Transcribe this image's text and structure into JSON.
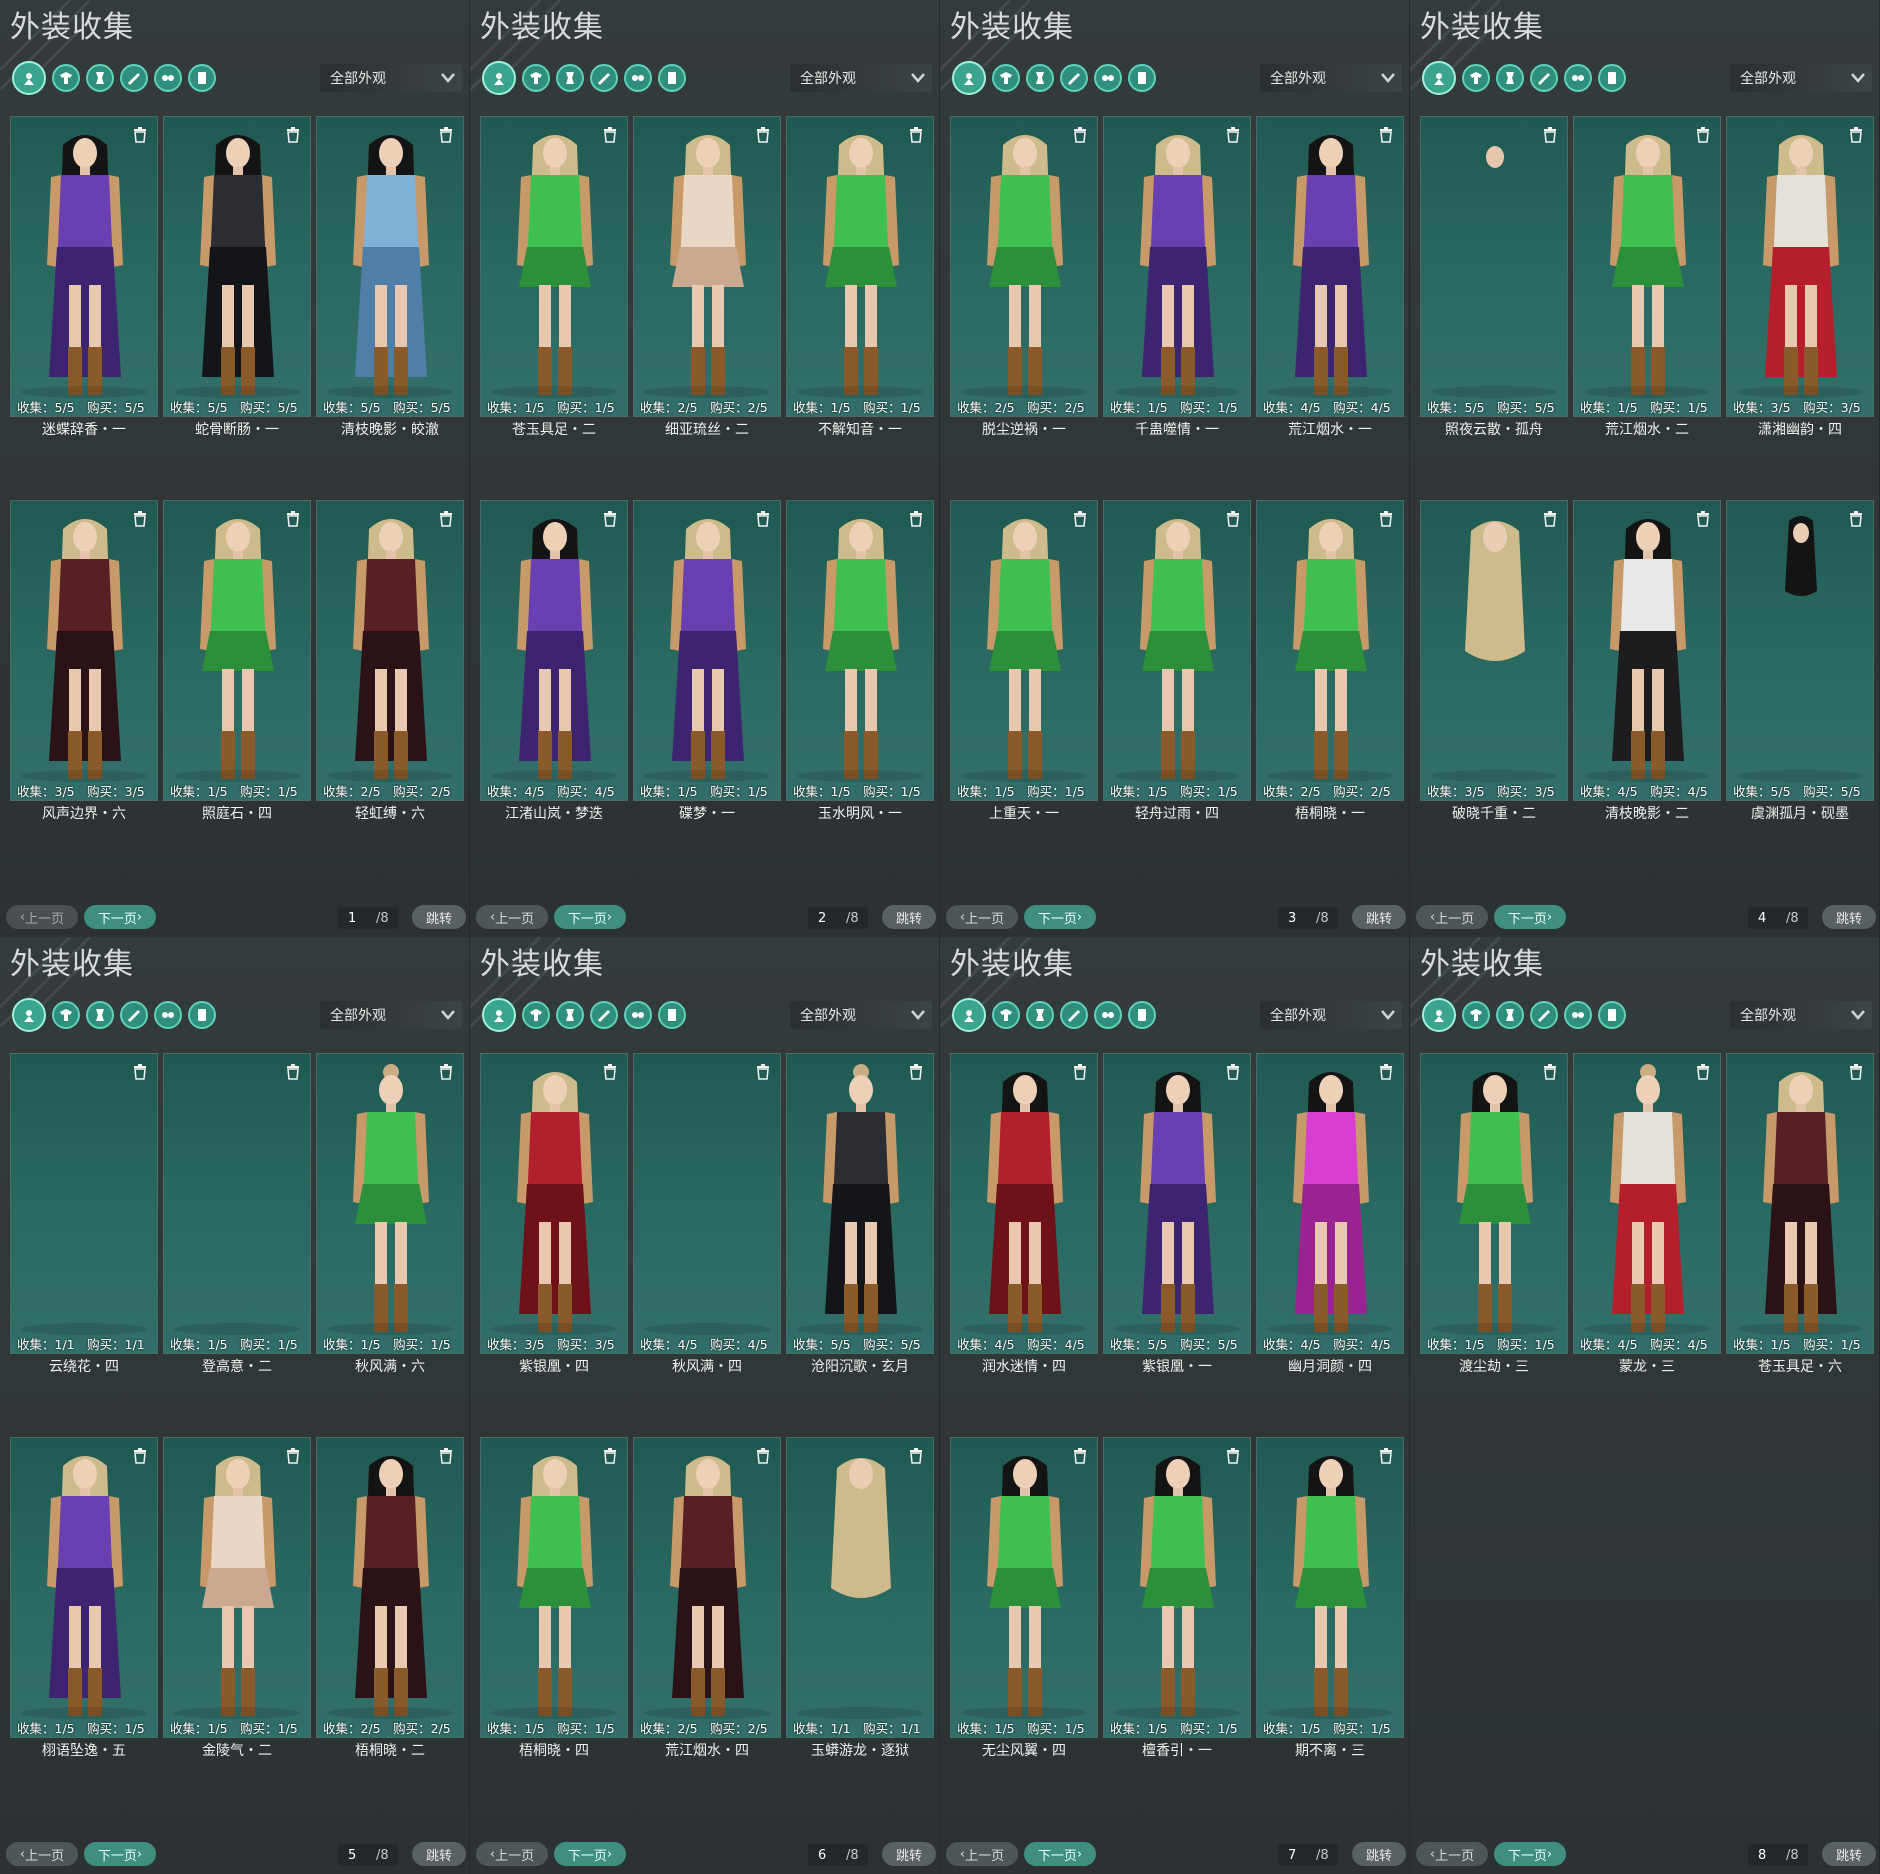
{
  "app": {
    "accent": "#3aa48d",
    "teal": "#2a6a62"
  },
  "panels": [
    {
      "title": "外装收集",
      "filter": "全部外观",
      "page": "1",
      "total": "/8",
      "pager": {
        "prev": "上一页",
        "next": "下一页",
        "jump": "跳转"
      },
      "items": [
        {
          "stats": "收集：5/5　购买：5/5",
          "name": "迷蝶辞香・一",
          "outfit": "purple",
          "hair": "dark"
        },
        {
          "stats": "收集：5/5　购买：5/5",
          "name": "蛇骨断肠・一",
          "outfit": "black",
          "hair": "dark"
        },
        {
          "stats": "收集：5/5　购买：5/5",
          "name": "清枝晚影・皎澈",
          "outfit": "blue",
          "hair": "dark"
        },
        {
          "stats": "收集：3/5　购买：3/5",
          "name": "风声边界・六",
          "outfit": "darkred",
          "hair": "blonde"
        },
        {
          "stats": "收集：1/5　购买：1/5",
          "name": "照庭石・四",
          "outfit": "green",
          "hair": "blonde"
        },
        {
          "stats": "收集：2/5　购买：2/5",
          "name": "轻虹缚・六",
          "outfit": "darkred",
          "hair": "blonde"
        }
      ]
    },
    {
      "title": "外装收集",
      "filter": "全部外观",
      "page": "2",
      "total": "/8",
      "pager": {
        "prev": "上一页",
        "next": "下一页",
        "jump": "跳转"
      },
      "items": [
        {
          "stats": "收集：1/5　购买：1/5",
          "name": "苍玉具足・二",
          "outfit": "green",
          "hair": "blonde"
        },
        {
          "stats": "收集：2/5　购买：2/5",
          "name": "细亚琉丝・二",
          "outfit": "nude",
          "hair": "blonde"
        },
        {
          "stats": "收集：1/5　购买：1/5",
          "name": "不解知音・一",
          "outfit": "green",
          "hair": "blonde"
        },
        {
          "stats": "收集：4/5　购买：4/5",
          "name": "江渚山岚・梦迭",
          "outfit": "purple",
          "hair": "dark"
        },
        {
          "stats": "收集：1/5　购买：1/5",
          "name": "碟梦・一",
          "outfit": "purple",
          "hair": "blonde"
        },
        {
          "stats": "收集：1/5　购买：1/5",
          "name": "玉水明风・一",
          "outfit": "green",
          "hair": "blonde"
        }
      ]
    },
    {
      "title": "外装收集",
      "filter": "全部外观",
      "page": "3",
      "total": "/8",
      "pager": {
        "prev": "上一页",
        "next": "下一页",
        "jump": "跳转"
      },
      "items": [
        {
          "stats": "收集：2/5　购买：2/5",
          "name": "脱尘逆祸・一",
          "outfit": "green",
          "hair": "blonde"
        },
        {
          "stats": "收集：1/5　购买：1/5",
          "name": "千蛊噬情・一",
          "outfit": "purple",
          "hair": "blonde"
        },
        {
          "stats": "收集：4/5　购买：4/5",
          "name": "荒江烟水・一",
          "outfit": "purple",
          "hair": "dark"
        },
        {
          "stats": "收集：1/5　购买：1/5",
          "name": "上重天・一",
          "outfit": "green",
          "hair": "blonde"
        },
        {
          "stats": "收集：1/5　购买：1/5",
          "name": "轻舟过雨・四",
          "outfit": "green",
          "hair": "blonde"
        },
        {
          "stats": "收集：2/5　购买：2/5",
          "name": "梧桐晓・一",
          "outfit": "green",
          "hair": "blonde"
        }
      ]
    },
    {
      "title": "外装收集",
      "filter": "全部外观",
      "page": "4",
      "total": "/8",
      "pager": {
        "prev": "上一页",
        "next": "下一页",
        "jump": "跳转"
      },
      "items": [
        {
          "stats": "收集：5/5　购买：5/5",
          "name": "照夜云散・孤舟",
          "outfit": "head",
          "hair": "none"
        },
        {
          "stats": "收集：1/5　购买：1/5",
          "name": "荒江烟水・二",
          "outfit": "green",
          "hair": "blonde"
        },
        {
          "stats": "收集：3/5　购买：3/5",
          "name": "潇湘幽韵・四",
          "outfit": "redwhite",
          "hair": "blonde"
        },
        {
          "stats": "收集：3/5　购买：3/5",
          "name": "破晓千重・二",
          "outfit": "haironly",
          "hair": "blonde"
        },
        {
          "stats": "收集：4/5　购买：4/5",
          "name": "清枝晚影・二",
          "outfit": "whiteblack",
          "hair": "dark"
        },
        {
          "stats": "收集：5/5　购买：5/5",
          "name": "虞渊孤月・砚墨",
          "outfit": "hairdark",
          "hair": "dark"
        }
      ]
    },
    {
      "title": "外装收集",
      "filter": "全部外观",
      "page": "5",
      "total": "/8",
      "pager": {
        "prev": "上一页",
        "next": "下一页",
        "jump": "跳转"
      },
      "items": [
        {
          "stats": "收集：1/1　购买：1/1",
          "name": "云绕花・四",
          "outfit": "empty",
          "hair": "none"
        },
        {
          "stats": "收集：1/5　购买：1/5",
          "name": "登高意・二",
          "outfit": "empty",
          "hair": "none"
        },
        {
          "stats": "收集：1/5　购买：1/5",
          "name": "秋风满・六",
          "outfit": "green",
          "hair": "bun"
        },
        {
          "stats": "收集：1/5　购买：1/5",
          "name": "栩语坠逸・五",
          "outfit": "purple",
          "hair": "blonde"
        },
        {
          "stats": "收集：1/5　购买：1/5",
          "name": "金陵气・二",
          "outfit": "nude",
          "hair": "blonde"
        },
        {
          "stats": "收集：2/5　购买：2/5",
          "name": "梧桐晓・二",
          "outfit": "darkred",
          "hair": "dark"
        }
      ]
    },
    {
      "title": "外装收集",
      "filter": "全部外观",
      "page": "6",
      "total": "/8",
      "pager": {
        "prev": "上一页",
        "next": "下一页",
        "jump": "跳转"
      },
      "items": [
        {
          "stats": "收集：3/5　购买：3/5",
          "name": "紫银凰・四",
          "outfit": "red",
          "hair": "blonde"
        },
        {
          "stats": "收集：4/5　购买：4/5",
          "name": "秋风满・四",
          "outfit": "empty",
          "hair": "none"
        },
        {
          "stats": "收集：5/5　购买：5/5",
          "name": "沧阳沉歌・玄月",
          "outfit": "black",
          "hair": "bun"
        },
        {
          "stats": "收集：1/5　购买：1/5",
          "name": "梧桐晓・四",
          "outfit": "green",
          "hair": "blonde"
        },
        {
          "stats": "收集：2/5　购买：2/5",
          "name": "荒江烟水・四",
          "outfit": "darkred",
          "hair": "blonde"
        },
        {
          "stats": "收集：1/1　购买：1/1",
          "name": "玉蟒游龙・逐狱",
          "outfit": "haironly",
          "hair": "blonde"
        }
      ]
    },
    {
      "title": "外装收集",
      "filter": "全部外观",
      "page": "7",
      "total": "/8",
      "pager": {
        "prev": "上一页",
        "next": "下一页",
        "jump": "跳转"
      },
      "items": [
        {
          "stats": "收集：4/5　购买：4/5",
          "name": "润水迷情・四",
          "outfit": "red",
          "hair": "dark"
        },
        {
          "stats": "收集：5/5　购买：5/5",
          "name": "紫银凰・一",
          "outfit": "purple",
          "hair": "dark"
        },
        {
          "stats": "收集：4/5　购买：4/5",
          "name": "幽月洞颜・四",
          "outfit": "pink",
          "hair": "dark"
        },
        {
          "stats": "收集：1/5　购买：1/5",
          "name": "无尘风翼・四",
          "outfit": "green",
          "hair": "dark"
        },
        {
          "stats": "收集：1/5　购买：1/5",
          "name": "檀香引・一",
          "outfit": "green",
          "hair": "dark"
        },
        {
          "stats": "收集：1/5　购买：1/5",
          "name": "期不离・三",
          "outfit": "green",
          "hair": "dark"
        }
      ]
    },
    {
      "title": "外装收集",
      "filter": "全部外观",
      "page": "8",
      "total": "/8",
      "pager": {
        "prev": "上一页",
        "next": "下一页",
        "jump": "跳转"
      },
      "items": [
        {
          "stats": "收集：1/5　购买：1/5",
          "name": "渡尘劫・三",
          "outfit": "green",
          "hair": "dark"
        },
        {
          "stats": "收集：4/5　购买：4/5",
          "name": "蒙龙・三",
          "outfit": "redwhite",
          "hair": "bun"
        },
        {
          "stats": "收集：1/5　购买：1/5",
          "name": "苍玉具足・六",
          "outfit": "darkred",
          "hair": "blonde"
        }
      ]
    }
  ]
}
